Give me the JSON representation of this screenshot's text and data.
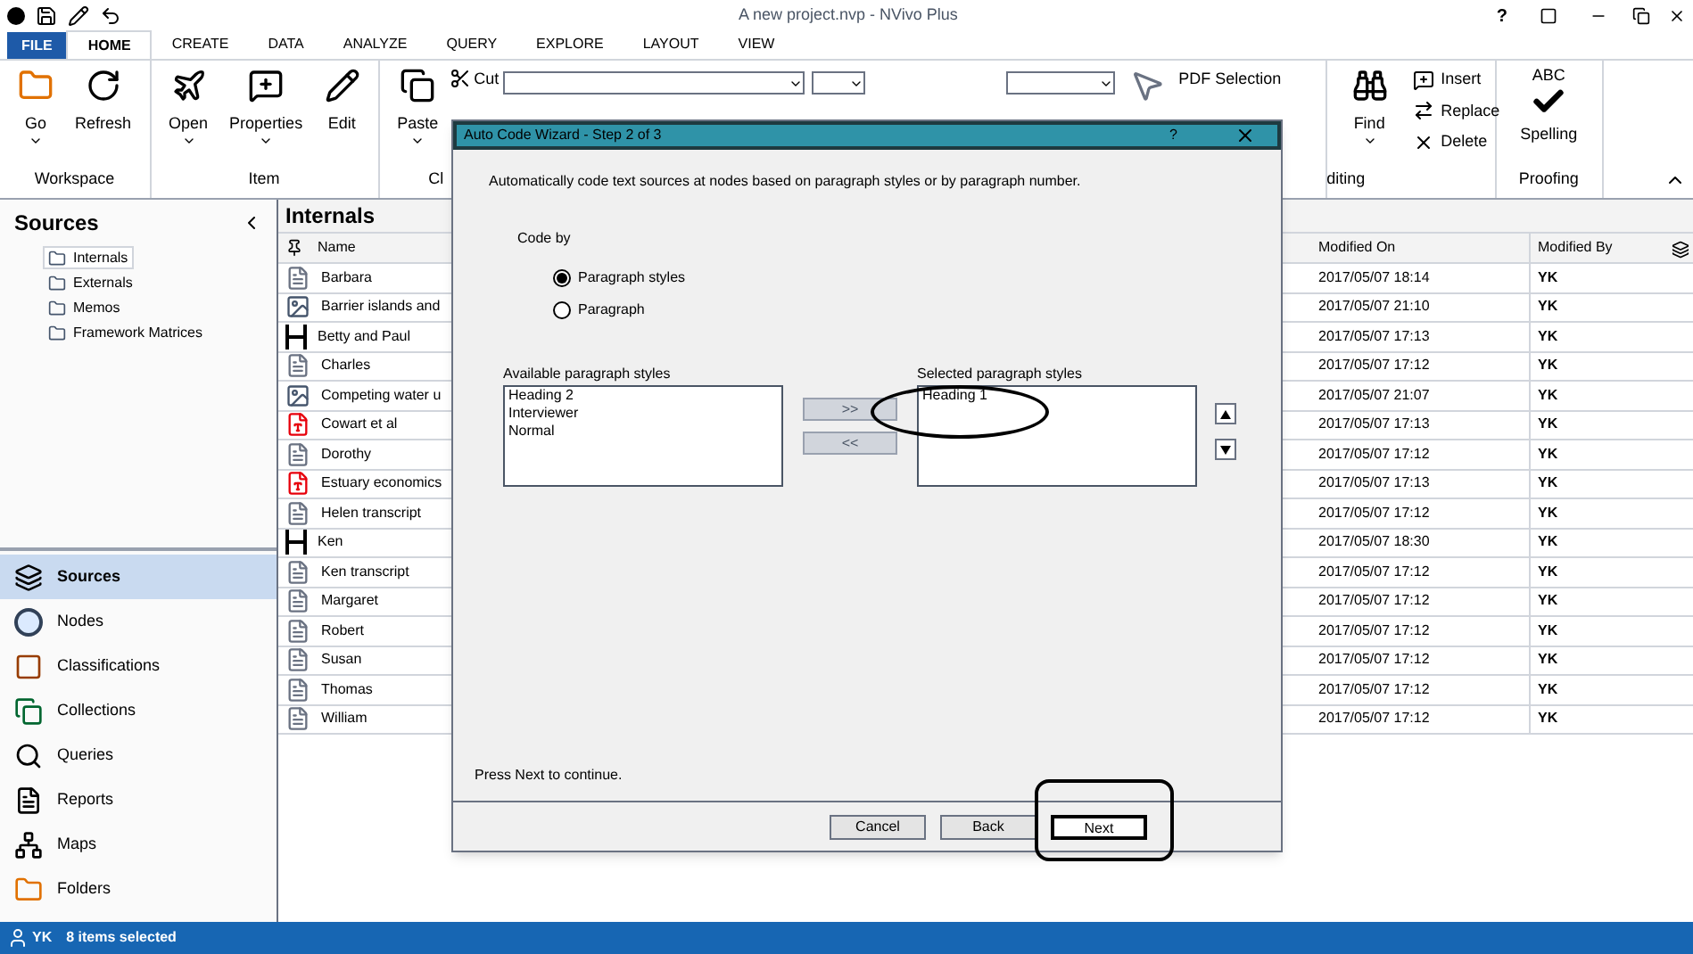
{
  "window": {
    "title": "A new project.nvp - NVivo Plus",
    "help": "?"
  },
  "ribbon_tabs": [
    {
      "label": "FILE",
      "kind": "file",
      "selected": false
    },
    {
      "label": "HOME",
      "kind": "tab",
      "selected": true
    },
    {
      "label": "CREATE",
      "kind": "tab",
      "selected": false
    },
    {
      "label": "DATA",
      "kind": "tab",
      "selected": false
    },
    {
      "label": "ANALYZE",
      "kind": "tab",
      "selected": false
    },
    {
      "label": "QUERY",
      "kind": "tab",
      "selected": false
    },
    {
      "label": "EXPLORE",
      "kind": "tab",
      "selected": false
    },
    {
      "label": "LAYOUT",
      "kind": "tab",
      "selected": false
    },
    {
      "label": "VIEW",
      "kind": "tab",
      "selected": false
    }
  ],
  "ribbon": {
    "workspace": {
      "label": "Workspace",
      "buttons": [
        {
          "label": "Go",
          "dropdown": true
        },
        {
          "label": "Refresh",
          "dropdown": false
        }
      ]
    },
    "item": {
      "label": "Item",
      "buttons": [
        {
          "label": "Open",
          "dropdown": true
        },
        {
          "label": "Properties",
          "dropdown": true
        },
        {
          "label": "Edit",
          "dropdown": false
        }
      ]
    },
    "clipboard": {
      "label": "Cl",
      "paste": "Paste",
      "cut": "Cut"
    },
    "pdf_selection": "PDF Selection",
    "editing": {
      "label": "diting",
      "find": "Find",
      "small": [
        "Insert",
        "Replace",
        "Delete"
      ]
    },
    "proofing": {
      "label": "Proofing",
      "abc": "ABC",
      "spelling": "Spelling"
    }
  },
  "sources_panel": {
    "title": "Sources",
    "tree": [
      {
        "label": "Internals",
        "selected": true
      },
      {
        "label": "Externals",
        "selected": false
      },
      {
        "label": "Memos",
        "selected": false
      },
      {
        "label": "Framework Matrices",
        "selected": false
      }
    ]
  },
  "navigation": [
    {
      "label": "Sources",
      "selected": true
    },
    {
      "label": "Nodes",
      "selected": false
    },
    {
      "label": "Classifications",
      "selected": false
    },
    {
      "label": "Collections",
      "selected": false
    },
    {
      "label": "Queries",
      "selected": false
    },
    {
      "label": "Reports",
      "selected": false
    },
    {
      "label": "Maps",
      "selected": false
    },
    {
      "label": "Folders",
      "selected": false
    }
  ],
  "list": {
    "title": "Internals",
    "columns": [
      "Name",
      "Modified On",
      "Modified By"
    ],
    "rows": [
      {
        "kind": "document",
        "name": "Barbara",
        "modified_on": "2017/05/07 18:14",
        "modified_by": "YK"
      },
      {
        "kind": "picture",
        "name": "Barrier islands and",
        "modified_on": "2017/05/07 21:10",
        "modified_by": "YK"
      },
      {
        "kind": "audio",
        "name": "Betty and Paul",
        "modified_on": "2017/05/07 17:13",
        "modified_by": "YK"
      },
      {
        "kind": "document",
        "name": "Charles",
        "modified_on": "2017/05/07 17:12",
        "modified_by": "YK"
      },
      {
        "kind": "picture",
        "name": "Competing water u",
        "modified_on": "2017/05/07 21:07",
        "modified_by": "YK"
      },
      {
        "kind": "pdf",
        "name": "Cowart et al",
        "modified_on": "2017/05/07 17:13",
        "modified_by": "YK"
      },
      {
        "kind": "document",
        "name": "Dorothy",
        "modified_on": "2017/05/07 17:12",
        "modified_by": "YK"
      },
      {
        "kind": "pdf",
        "name": "Estuary economics",
        "modified_on": "2017/05/07 17:13",
        "modified_by": "YK"
      },
      {
        "kind": "document",
        "name": "Helen transcript",
        "modified_on": "2017/05/07 17:12",
        "modified_by": "YK"
      },
      {
        "kind": "audio",
        "name": "Ken",
        "modified_on": "2017/05/07 18:30",
        "modified_by": "YK"
      },
      {
        "kind": "document",
        "name": "Ken transcript",
        "modified_on": "2017/05/07 17:12",
        "modified_by": "YK"
      },
      {
        "kind": "document",
        "name": "Margaret",
        "modified_on": "2017/05/07 17:12",
        "modified_by": "YK"
      },
      {
        "kind": "document",
        "name": "Robert",
        "modified_on": "2017/05/07 17:12",
        "modified_by": "YK"
      },
      {
        "kind": "document",
        "name": "Susan",
        "modified_on": "2017/05/07 17:12",
        "modified_by": "YK"
      },
      {
        "kind": "document",
        "name": "Thomas",
        "modified_on": "2017/05/07 17:12",
        "modified_by": "YK"
      },
      {
        "kind": "document",
        "name": "William",
        "modified_on": "2017/05/07 17:12",
        "modified_by": "YK"
      }
    ]
  },
  "dialog": {
    "title": "Auto Code Wizard - Step 2 of 3",
    "help": "?",
    "description": "Automatically code text sources at nodes based on paragraph styles or by paragraph number.",
    "code_by": {
      "label": "Code by",
      "options": [
        {
          "label": "Paragraph styles",
          "selected": true
        },
        {
          "label": "Paragraph",
          "selected": false
        }
      ]
    },
    "available": {
      "label": "Available paragraph styles",
      "items": [
        "Heading 2",
        "Interviewer",
        "Normal"
      ]
    },
    "add": ">>",
    "remove": "<<",
    "selected": {
      "label": "Selected paragraph styles",
      "items": [
        "Heading 1"
      ]
    },
    "hint": "Press Next to continue.",
    "buttons": [
      {
        "label": "Cancel",
        "default": false
      },
      {
        "label": "Back",
        "default": false
      },
      {
        "label": "Next",
        "default": true
      }
    ]
  },
  "status_bar": {
    "user": "YK",
    "text": "8 items selected"
  }
}
